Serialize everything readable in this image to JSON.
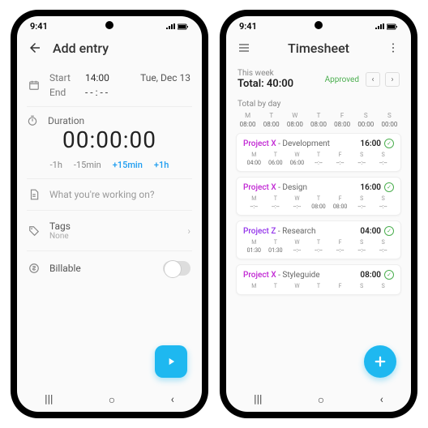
{
  "status": {
    "time": "9:41"
  },
  "left": {
    "title": "Add entry",
    "start_label": "Start",
    "start_time": "14:00",
    "start_date": "Tue, Dec 13",
    "end_label": "End",
    "end_time": "- - : - -",
    "duration_label": "Duration",
    "duration_value": "00:00:00",
    "quick": [
      "-1h",
      "-15min",
      "+15min",
      "+1h"
    ],
    "description_placeholder": "What you're working on?",
    "tags_label": "Tags",
    "tags_value": "None",
    "billable_label": "Billable"
  },
  "right": {
    "title": "Timesheet",
    "week_label": "This week",
    "total_label": "Total: 40:00",
    "status": "Approved",
    "section": "Total by day",
    "days": [
      "M",
      "T",
      "W",
      "T",
      "F",
      "S",
      "S"
    ],
    "day_totals": [
      "08:00",
      "08:00",
      "08:00",
      "08:00",
      "08:00",
      "00:00",
      "00:00"
    ],
    "entries": [
      {
        "project": "Project X",
        "task": "Development",
        "total": "16:00",
        "projClass": "",
        "vals": [
          "04:00",
          "06:00",
          "06:00",
          "--:--",
          "--:--",
          "--:--",
          "--:--"
        ]
      },
      {
        "project": "Project X",
        "task": "Design",
        "total": "16:00",
        "projClass": "",
        "vals": [
          "--:--",
          "--:--",
          "--:--",
          "08:00",
          "08:00",
          "--:--",
          "--:--"
        ]
      },
      {
        "project": "Project Z",
        "task": "Research",
        "total": "04:00",
        "projClass": "z",
        "vals": [
          "01:30",
          "01:30",
          "--:--",
          "--:--",
          "--:--",
          "--:--",
          "--:--"
        ]
      },
      {
        "project": "Project X",
        "task": "Styleguide",
        "total": "08:00",
        "projClass": "",
        "vals": [
          "",
          "",
          "",
          "",
          "",
          "",
          ""
        ]
      }
    ]
  }
}
